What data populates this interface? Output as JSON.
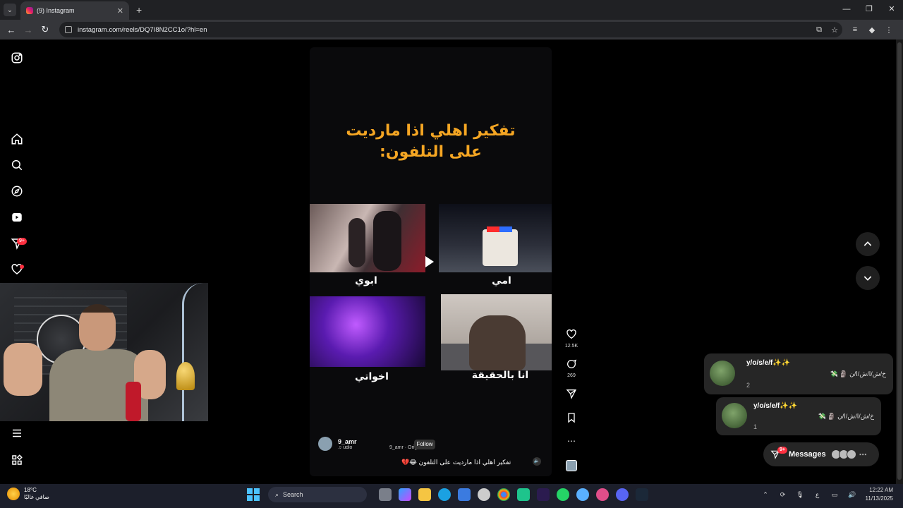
{
  "browser": {
    "tab_title": "(9) Instagram",
    "tab_close": "✕",
    "new_tab": "+",
    "url": "instagram.com/reels/DQ7I8N2CC1o/?hl=en",
    "window_controls": [
      "—",
      "❐",
      "✕"
    ],
    "nav": {
      "back": "←",
      "forward": "→",
      "reload": "↻"
    }
  },
  "sidebar": {
    "items": [
      "instagram-logo",
      "home",
      "search",
      "explore",
      "reels",
      "messages",
      "notifications",
      "more",
      "also-from-meta"
    ],
    "messages_badge": "9+"
  },
  "reel": {
    "title": "تفكير اهلي اذا ماردیت على التلفون:",
    "captions": [
      "ابوي",
      "امي",
      "اخواتي",
      "انا بالحقيقة"
    ],
    "author": "9_amr",
    "audio": "♫ udio",
    "follow": "Follow",
    "original": "9_amr · Original a",
    "caption": "تفكير اهلي اذا ماردیت على التلفون 😂💔",
    "sound_icon": "🔈"
  },
  "actions": {
    "likes": "12.5K",
    "comments": "269"
  },
  "notifications": [
    {
      "name": "y/o/s/e/f✨✨",
      "message": "خ/ش/ا/ش/ا/ن 🗿 💸",
      "count": "2"
    },
    {
      "name": "y/o/s/e/f✨✨",
      "message": "خ/ش/ا/ش/ا/ن 🗿 💸",
      "count": "1"
    }
  ],
  "messages": {
    "label": "Messages",
    "badge": "9+",
    "more": "⋯"
  },
  "taskbar": {
    "temp": "18°C",
    "weather": "صافي غالبًا",
    "search": "Search",
    "lang": "ع",
    "time": "12:22 AM",
    "date": "11/13/2025"
  },
  "colors": {
    "accent_orange": "#f5a623",
    "badge_red": "#ff3040"
  }
}
